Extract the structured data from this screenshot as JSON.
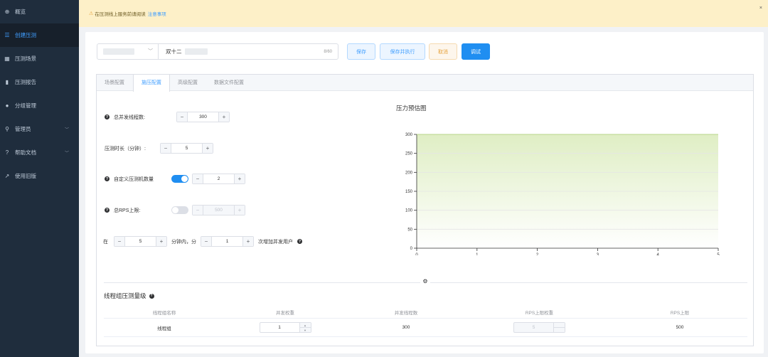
{
  "sidebar": {
    "items": [
      {
        "label": "概览",
        "icon": "dashboard-icon",
        "glyph": "⊕"
      },
      {
        "label": "创建压测",
        "icon": "list-icon",
        "glyph": "☰"
      },
      {
        "label": "压测场景",
        "icon": "grid-icon",
        "glyph": "▦"
      },
      {
        "label": "压测报告",
        "icon": "bar-chart-icon",
        "glyph": "▮"
      },
      {
        "label": "分组管理",
        "icon": "user-icon",
        "glyph": "●"
      },
      {
        "label": "管理员",
        "icon": "admin-icon",
        "glyph": "⚲"
      },
      {
        "label": "帮助文档",
        "icon": "help-circle-icon",
        "glyph": "?"
      },
      {
        "label": "使用旧版",
        "icon": "external-link-icon",
        "glyph": "↗"
      }
    ],
    "active_index": 1
  },
  "notice": {
    "text": "在压测线上服务前请阅读",
    "link": "注意事项",
    "close": "×"
  },
  "header": {
    "scenario_name": "双十二",
    "char_count": "8/60",
    "buttons": {
      "save": "保存",
      "save_run": "保存并执行",
      "cancel": "取消",
      "debug": "调试"
    }
  },
  "tabs": [
    {
      "label": "场景配置",
      "active": false
    },
    {
      "label": "施压配置",
      "active": true
    },
    {
      "label": "高级配置",
      "active": false
    },
    {
      "label": "数据文件配置",
      "active": false
    }
  ],
  "form": {
    "total_threads": {
      "label": "总并发线程数:",
      "value": "300"
    },
    "duration": {
      "label": "压测时长（分钟）:",
      "value": "5"
    },
    "custom_machines": {
      "label": "自定义压测机数量",
      "enabled": true,
      "value": "2"
    },
    "rps_limit": {
      "label": "总RPS上限:",
      "enabled": false,
      "value": "500"
    },
    "ramp": {
      "prefix": "在",
      "minutes": "5",
      "middle": "分钟内，分",
      "steps": "1",
      "suffix": "次增加并发用户"
    }
  },
  "chart_data": {
    "type": "area",
    "title": "压力预估图",
    "x": [
      0,
      5
    ],
    "values": [
      300,
      300
    ],
    "xticks": [
      "0",
      "1",
      "2",
      "3",
      "4",
      "5"
    ],
    "yticks": [
      "0",
      "50",
      "100",
      "150",
      "200",
      "250",
      "300"
    ],
    "xlim": [
      0,
      5
    ],
    "ylim": [
      0,
      300
    ],
    "grid": true,
    "fill_color": "#dfeec4"
  },
  "thread_group": {
    "title": "线程组压测量级",
    "columns": [
      "线程组名称",
      "并发权重",
      "并发线程数",
      "RPS上限权重",
      "RPS上限"
    ],
    "rows": [
      {
        "name": "线程组",
        "weight": "1",
        "threads": "300",
        "rps_weight": "5",
        "rps": "500"
      }
    ]
  },
  "colors": {
    "primary": "#1f8ef1",
    "sidebar": "#1f2d3d",
    "warning": "#e6a23c"
  }
}
